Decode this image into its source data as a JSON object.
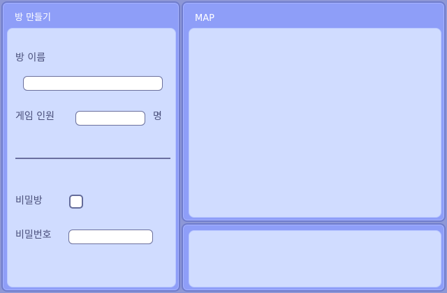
{
  "left_panel": {
    "title": "방 만들기",
    "room_name_label": "방 이름",
    "room_name_value": "",
    "players_label": "게임 인원",
    "players_value": "",
    "players_unit": "명",
    "private_room_label": "비밀방",
    "private_room_checked": false,
    "password_label": "비밀번호",
    "password_value": ""
  },
  "map_panel": {
    "title": "MAP"
  },
  "bottom_panel": {}
}
